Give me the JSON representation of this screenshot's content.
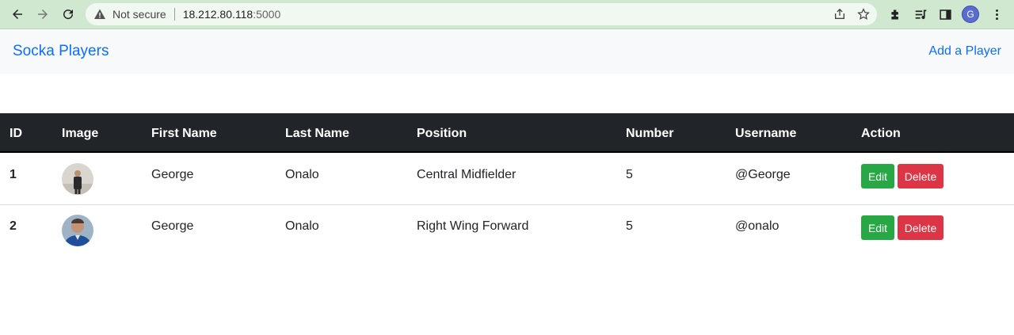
{
  "browser": {
    "security_label": "Not secure",
    "url_host": "18.212.80.118",
    "url_port": ":5000",
    "profile_initial": "G"
  },
  "navbar": {
    "brand": "Socka Players",
    "add_link": "Add a Player"
  },
  "table": {
    "headers": [
      "ID",
      "Image",
      "First Name",
      "Last Name",
      "Position",
      "Number",
      "Username",
      "Action"
    ],
    "rows": [
      {
        "id": "1",
        "first_name": "George",
        "last_name": "Onalo",
        "position": "Central Midfielder",
        "number": "5",
        "username": "@George",
        "edit": "Edit",
        "delete": "Delete"
      },
      {
        "id": "2",
        "first_name": "George",
        "last_name": "Onalo",
        "position": "Right Wing Forward",
        "number": "5",
        "username": "@onalo",
        "edit": "Edit",
        "delete": "Delete"
      }
    ]
  },
  "colors": {
    "brand": "#0d6efd",
    "header_bg": "#212529",
    "edit_button": "#28a745",
    "delete_button": "#dc3545"
  }
}
